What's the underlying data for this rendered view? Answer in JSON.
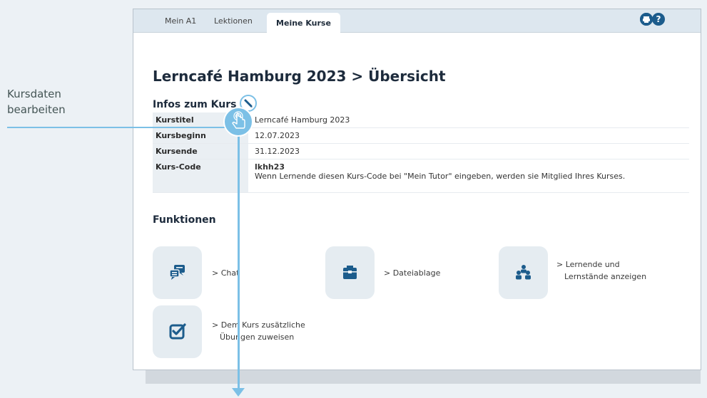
{
  "annotation": {
    "line1": "Kursdaten",
    "line2": "bearbeiten"
  },
  "tabs": {
    "t1": "Mein A1",
    "t2": "Lektionen",
    "active": "Meine Kurse"
  },
  "icons": {
    "print": "print-icon",
    "help": "help-icon"
  },
  "page": {
    "title": "Lerncafé Hamburg 2023 > Übersicht"
  },
  "info": {
    "heading": "Infos zum Kurs",
    "rows": [
      {
        "label": "Kurstitel",
        "value": "Lerncafé Hamburg 2023"
      },
      {
        "label": "Kursbeginn",
        "value": "12.07.2023"
      },
      {
        "label": "Kursende",
        "value": "31.12.2023"
      },
      {
        "label": "Kurs-Code",
        "value": "lkhh23",
        "note": "Wenn Lernende diesen Kurs-Code bei \"Mein Tutor\" eingeben, werden sie Mitglied Ihres Kurses."
      }
    ]
  },
  "functions": {
    "heading": "Funktionen",
    "chat": "> Chat",
    "files": "> Dateiablage",
    "learners_l1": "> Lernende und",
    "learners_l2": "Lernstände anzeigen",
    "exercises_l1": "> Dem Kurs zusätzliche",
    "exercises_l2": "Übungen zuweisen"
  },
  "colors": {
    "accent": "#7cc0e6",
    "brand": "#1c5c8c"
  }
}
